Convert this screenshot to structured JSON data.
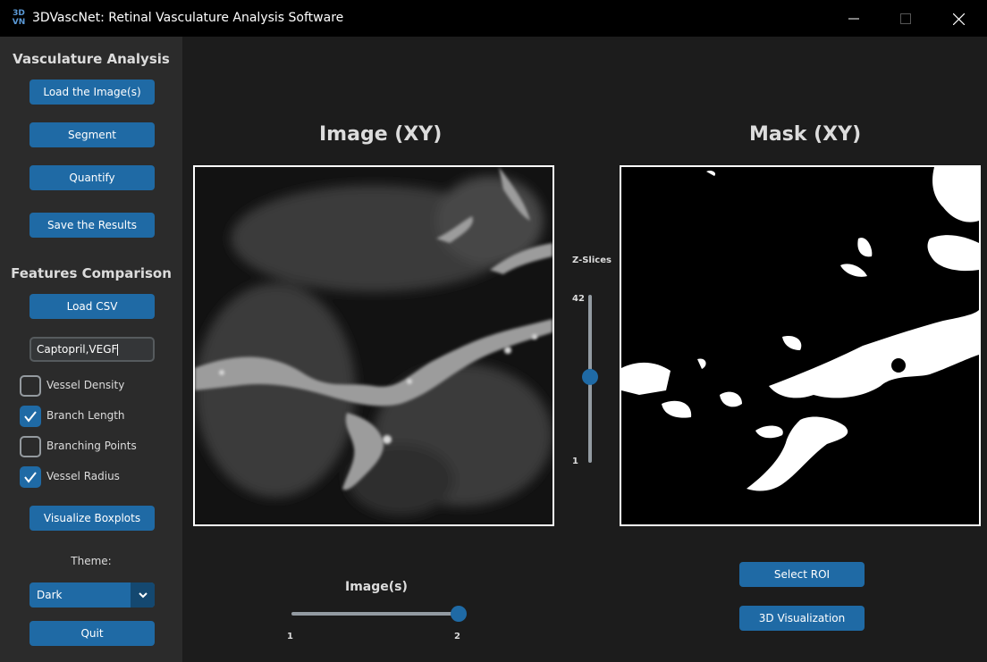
{
  "window": {
    "icon_text_top": "3D",
    "icon_text_bottom": "VN",
    "title": "3DVascNet: Retinal Vasculature Analysis Software"
  },
  "sidebar": {
    "vasculature_title": "Vasculature Analysis",
    "load_button": "Load the Image(s)",
    "segment_button": "Segment",
    "quantify_button": "Quantify",
    "save_button": "Save the Results",
    "features_title": "Features Comparison",
    "load_csv_button": "Load CSV",
    "groups_input_value": "Captopril,VEGF",
    "features": [
      {
        "label": "Vessel Density",
        "checked": false
      },
      {
        "label": "Branch Length",
        "checked": true
      },
      {
        "label": "Branching Points",
        "checked": false
      },
      {
        "label": "Vessel Radius",
        "checked": true
      }
    ],
    "visualize_button": "Visualize Boxplots",
    "theme_label": "Theme:",
    "theme_value": "Dark",
    "quit_button": "Quit"
  },
  "main": {
    "image_title": "Image (XY)",
    "mask_title": "Mask (XY)",
    "zslices": {
      "label": "Z-Slices",
      "max_label": "42",
      "min_label": "1",
      "min": 1,
      "max": 42,
      "value": 22
    },
    "images_slider": {
      "label": "Image(s)",
      "min_label": "1",
      "max_label": "2",
      "min": 1,
      "max": 2,
      "value": 2
    },
    "select_roi_button": "Select ROI",
    "visualization_button": "3D Visualization"
  },
  "colors": {
    "accent": "#1f6aa5",
    "accent_dark": "#144870",
    "sidebar_bg": "#2b2b2b",
    "main_bg": "#1c1c1c",
    "text": "#dcdcdc"
  }
}
